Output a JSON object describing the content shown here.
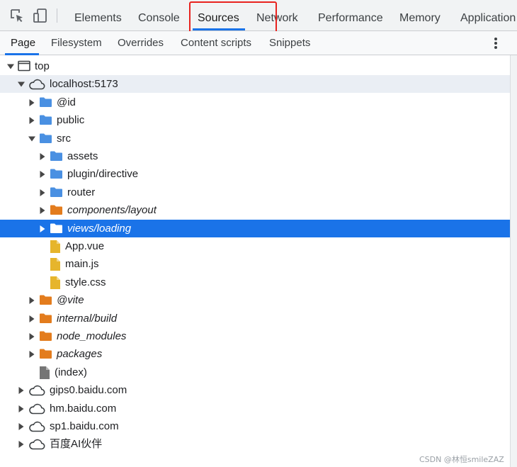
{
  "toolbar": {
    "icons": [
      "inspect-element-icon",
      "device-toolbar-icon"
    ],
    "tabs": [
      {
        "label": "Elements",
        "active": false
      },
      {
        "label": "Console",
        "active": false
      },
      {
        "label": "Sources",
        "active": true
      },
      {
        "label": "Network",
        "active": false
      },
      {
        "label": "Performance",
        "active": false
      },
      {
        "label": "Memory",
        "active": false
      },
      {
        "label": "Application",
        "active": false
      }
    ]
  },
  "subtabs": [
    {
      "label": "Page",
      "active": true
    },
    {
      "label": "Filesystem",
      "active": false
    },
    {
      "label": "Overrides",
      "active": false
    },
    {
      "label": "Content scripts",
      "active": false
    },
    {
      "label": "Snippets",
      "active": false
    }
  ],
  "tree": [
    {
      "label": "top",
      "depth": 0,
      "icon": "frame",
      "state": "expanded",
      "italic": false
    },
    {
      "label": "localhost:5173",
      "depth": 1,
      "icon": "cloud",
      "state": "expanded",
      "italic": false,
      "hover": true
    },
    {
      "label": "@id",
      "depth": 2,
      "icon": "folder-blue",
      "state": "collapsed",
      "italic": false
    },
    {
      "label": "public",
      "depth": 2,
      "icon": "folder-blue",
      "state": "collapsed",
      "italic": false
    },
    {
      "label": "src",
      "depth": 2,
      "icon": "folder-blue",
      "state": "expanded",
      "italic": false
    },
    {
      "label": "assets",
      "depth": 3,
      "icon": "folder-blue",
      "state": "collapsed",
      "italic": false
    },
    {
      "label": "plugin/directive",
      "depth": 3,
      "icon": "folder-blue",
      "state": "collapsed",
      "italic": false
    },
    {
      "label": "router",
      "depth": 3,
      "icon": "folder-blue",
      "state": "collapsed",
      "italic": false
    },
    {
      "label": "components/layout",
      "depth": 3,
      "icon": "folder-orange",
      "state": "collapsed",
      "italic": true
    },
    {
      "label": "views/loading",
      "depth": 3,
      "icon": "folder-white",
      "state": "collapsed",
      "italic": true,
      "selected": true
    },
    {
      "label": "App.vue",
      "depth": 3,
      "icon": "file-yellow",
      "state": "leaf",
      "italic": false
    },
    {
      "label": "main.js",
      "depth": 3,
      "icon": "file-yellow",
      "state": "leaf",
      "italic": false
    },
    {
      "label": "style.css",
      "depth": 3,
      "icon": "file-yellow",
      "state": "leaf",
      "italic": false
    },
    {
      "label": "@vite",
      "depth": 2,
      "icon": "folder-orange",
      "state": "collapsed",
      "italic": true
    },
    {
      "label": "internal/build",
      "depth": 2,
      "icon": "folder-orange",
      "state": "collapsed",
      "italic": true
    },
    {
      "label": "node_modules",
      "depth": 2,
      "icon": "folder-orange",
      "state": "collapsed",
      "italic": true
    },
    {
      "label": "packages",
      "depth": 2,
      "icon": "folder-orange",
      "state": "collapsed",
      "italic": true
    },
    {
      "label": "(index)",
      "depth": 2,
      "icon": "file-gray",
      "state": "leaf",
      "italic": false
    },
    {
      "label": "gips0.baidu.com",
      "depth": 1,
      "icon": "cloud",
      "state": "collapsed",
      "italic": false
    },
    {
      "label": "hm.baidu.com",
      "depth": 1,
      "icon": "cloud",
      "state": "collapsed",
      "italic": false
    },
    {
      "label": "sp1.baidu.com",
      "depth": 1,
      "icon": "cloud",
      "state": "collapsed",
      "italic": false
    },
    {
      "label": "百度AI伙伴",
      "depth": 1,
      "icon": "cloud",
      "state": "collapsed",
      "italic": false
    }
  ],
  "colors": {
    "accent": "#1a73e8",
    "folder_blue": "#4a90e2",
    "folder_orange": "#e37c1d",
    "file_yellow": "#e6b52c",
    "file_gray": "#757575",
    "highlight_red": "#e8231f"
  },
  "watermark": "CSDN @林恒smileZAZ"
}
